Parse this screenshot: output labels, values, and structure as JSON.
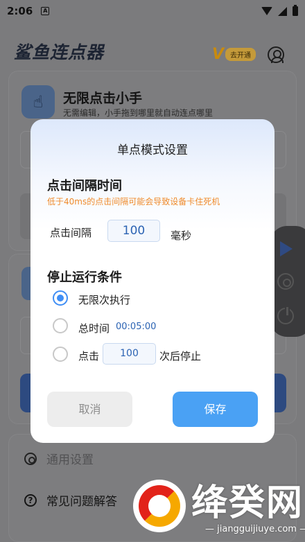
{
  "status_bar": {
    "time": "2:06",
    "app_glyph": "A"
  },
  "app": {
    "title": "鲨鱼连点器",
    "vip_mark": "V",
    "vip_button": "去开通"
  },
  "feature": {
    "title": "无限点击小手",
    "description": "无需编辑，小手拖到哪里就自动连点哪里"
  },
  "menu": {
    "settings": "通用设置",
    "faq": "常见问题解答",
    "faq_icon": "?"
  },
  "watermark": {
    "name": "绛癸网",
    "url": "— jiangguijiuye.com —"
  },
  "dialog": {
    "title": "单点模式设置",
    "interval_section": {
      "title": "点击间隔时间",
      "warning": "低于40ms的点击间隔可能会导致设备卡住死机",
      "label": "点击间隔",
      "value": "100",
      "unit": "毫秒"
    },
    "stop_section": {
      "title": "停止运行条件",
      "options": [
        {
          "label": "无限次执行",
          "checked": true
        },
        {
          "label": "总时间",
          "value": "00:05:00",
          "checked": false
        },
        {
          "label": "点击",
          "value": "100",
          "suffix": "次后停止",
          "checked": false
        }
      ]
    },
    "cancel_label": "取消",
    "save_label": "保存"
  },
  "colors": {
    "accent": "#3f8ef5",
    "save_button": "#4aa1f4",
    "warning": "#ef8b2c",
    "value_text": "#2b63b3"
  }
}
